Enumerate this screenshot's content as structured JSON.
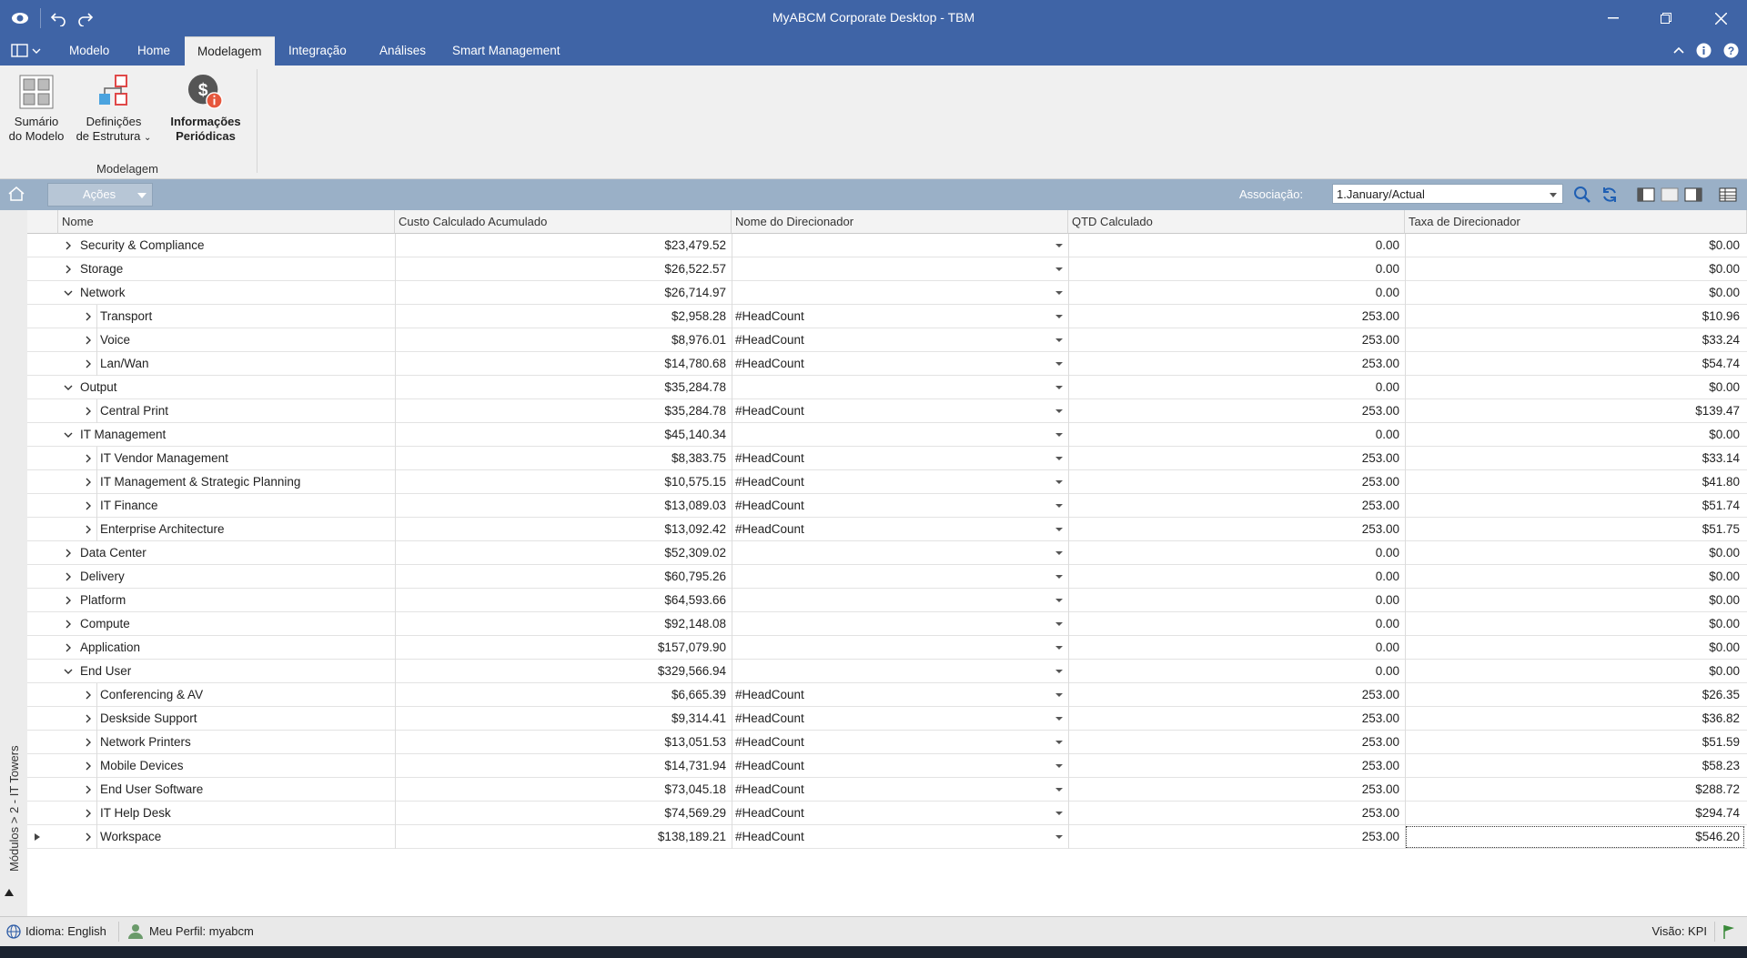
{
  "window": {
    "title": "MyABCM Corporate Desktop - TBM"
  },
  "menu": {
    "items": [
      {
        "label": "Modelo"
      },
      {
        "label": "Home"
      },
      {
        "label": "Modelagem"
      },
      {
        "label": "Integração"
      },
      {
        "label": "Análises"
      },
      {
        "label": "Smart Management"
      }
    ],
    "active": "Modelagem"
  },
  "ribbon": {
    "sumario": {
      "line1": "Sumário",
      "line2": "do Modelo"
    },
    "definicoes": {
      "line1": "Definições",
      "line2": "de Estrutura"
    },
    "informacoes": {
      "line1": "Informações",
      "line2": "Periódicas"
    },
    "group_label": "Modelagem"
  },
  "toolbar": {
    "acoes_label": "Ações",
    "assoc_label": "Associação:",
    "assoc_value": "1.January/Actual"
  },
  "side_label": "Módulos > 2 - IT Towers",
  "grid": {
    "columns": [
      "Nome",
      "Custo Calculado Acumulado",
      "Nome do Direcionador",
      "QTD Calculado",
      "Taxa de Direcionador"
    ],
    "rows": [
      {
        "level": 0,
        "state": "collapsed",
        "name": "Security & Compliance",
        "cost": "$23,479.52",
        "driver": "",
        "qty": "0.00",
        "rate": "$0.00"
      },
      {
        "level": 0,
        "state": "collapsed",
        "name": "Storage",
        "cost": "$26,522.57",
        "driver": "",
        "qty": "0.00",
        "rate": "$0.00"
      },
      {
        "level": 0,
        "state": "expanded",
        "name": "Network",
        "cost": "$26,714.97",
        "driver": "",
        "qty": "0.00",
        "rate": "$0.00"
      },
      {
        "level": 1,
        "state": "collapsed",
        "name": "Transport",
        "cost": "$2,958.28",
        "driver": "#HeadCount",
        "qty": "253.00",
        "rate": "$10.96"
      },
      {
        "level": 1,
        "state": "collapsed",
        "name": "Voice",
        "cost": "$8,976.01",
        "driver": "#HeadCount",
        "qty": "253.00",
        "rate": "$33.24"
      },
      {
        "level": 1,
        "state": "collapsed",
        "name": "Lan/Wan",
        "cost": "$14,780.68",
        "driver": "#HeadCount",
        "qty": "253.00",
        "rate": "$54.74"
      },
      {
        "level": 0,
        "state": "expanded",
        "name": "Output",
        "cost": "$35,284.78",
        "driver": "",
        "qty": "0.00",
        "rate": "$0.00"
      },
      {
        "level": 1,
        "state": "collapsed",
        "name": "Central Print",
        "cost": "$35,284.78",
        "driver": "#HeadCount",
        "qty": "253.00",
        "rate": "$139.47"
      },
      {
        "level": 0,
        "state": "expanded",
        "name": "IT Management",
        "cost": "$45,140.34",
        "driver": "",
        "qty": "0.00",
        "rate": "$0.00"
      },
      {
        "level": 1,
        "state": "collapsed",
        "name": "IT Vendor Management",
        "cost": "$8,383.75",
        "driver": "#HeadCount",
        "qty": "253.00",
        "rate": "$33.14"
      },
      {
        "level": 1,
        "state": "collapsed",
        "name": "IT Management & Strategic Planning",
        "cost": "$10,575.15",
        "driver": "#HeadCount",
        "qty": "253.00",
        "rate": "$41.80"
      },
      {
        "level": 1,
        "state": "collapsed",
        "name": "IT Finance",
        "cost": "$13,089.03",
        "driver": "#HeadCount",
        "qty": "253.00",
        "rate": "$51.74"
      },
      {
        "level": 1,
        "state": "collapsed",
        "name": "Enterprise Architecture",
        "cost": "$13,092.42",
        "driver": "#HeadCount",
        "qty": "253.00",
        "rate": "$51.75"
      },
      {
        "level": 0,
        "state": "collapsed",
        "name": "Data Center",
        "cost": "$52,309.02",
        "driver": "",
        "qty": "0.00",
        "rate": "$0.00"
      },
      {
        "level": 0,
        "state": "collapsed",
        "name": "Delivery",
        "cost": "$60,795.26",
        "driver": "",
        "qty": "0.00",
        "rate": "$0.00"
      },
      {
        "level": 0,
        "state": "collapsed",
        "name": "Platform",
        "cost": "$64,593.66",
        "driver": "",
        "qty": "0.00",
        "rate": "$0.00"
      },
      {
        "level": 0,
        "state": "collapsed",
        "name": "Compute",
        "cost": "$92,148.08",
        "driver": "",
        "qty": "0.00",
        "rate": "$0.00"
      },
      {
        "level": 0,
        "state": "collapsed",
        "name": "Application",
        "cost": "$157,079.90",
        "driver": "",
        "qty": "0.00",
        "rate": "$0.00"
      },
      {
        "level": 0,
        "state": "expanded",
        "name": "End User",
        "cost": "$329,566.94",
        "driver": "",
        "qty": "0.00",
        "rate": "$0.00"
      },
      {
        "level": 1,
        "state": "collapsed",
        "name": "Conferencing & AV",
        "cost": "$6,665.39",
        "driver": "#HeadCount",
        "qty": "253.00",
        "rate": "$26.35"
      },
      {
        "level": 1,
        "state": "collapsed",
        "name": "Deskside Support",
        "cost": "$9,314.41",
        "driver": "#HeadCount",
        "qty": "253.00",
        "rate": "$36.82"
      },
      {
        "level": 1,
        "state": "collapsed",
        "name": "Network Printers",
        "cost": "$13,051.53",
        "driver": "#HeadCount",
        "qty": "253.00",
        "rate": "$51.59"
      },
      {
        "level": 1,
        "state": "collapsed",
        "name": "Mobile Devices",
        "cost": "$14,731.94",
        "driver": "#HeadCount",
        "qty": "253.00",
        "rate": "$58.23"
      },
      {
        "level": 1,
        "state": "collapsed",
        "name": "End User Software",
        "cost": "$73,045.18",
        "driver": "#HeadCount",
        "qty": "253.00",
        "rate": "$288.72"
      },
      {
        "level": 1,
        "state": "collapsed",
        "name": "IT Help Desk",
        "cost": "$74,569.29",
        "driver": "#HeadCount",
        "qty": "253.00",
        "rate": "$294.74"
      },
      {
        "level": 1,
        "state": "collapsed",
        "name": "Workspace",
        "cost": "$138,189.21",
        "driver": "#HeadCount",
        "qty": "253.00",
        "rate": "$546.20",
        "current": true
      }
    ]
  },
  "status": {
    "idioma": "Idioma: English",
    "perfil": "Meu Perfil: myabcm",
    "visao": "Visão: KPI"
  },
  "colors": {
    "titlebar": "#3f64a6",
    "toolbar": "#9ab0c7",
    "ribbon": "#f0f0f0"
  }
}
